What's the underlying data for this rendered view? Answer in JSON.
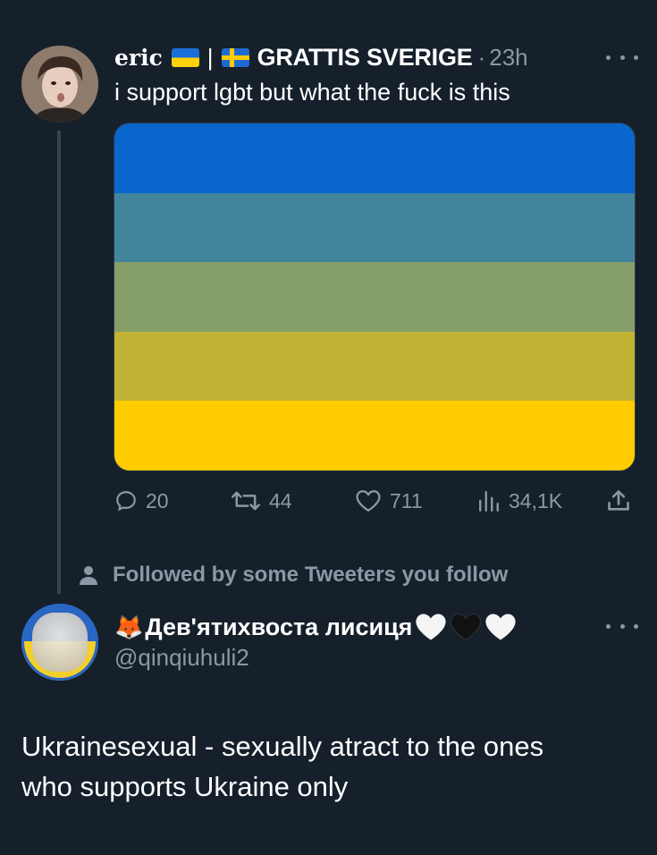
{
  "tweet": {
    "author_name": "eric",
    "author_flag_1": "ukraine-flag",
    "separator": "|",
    "author_flag_2": "sweden-flag",
    "author_name_suffix": "GRATTIS SVERIGE",
    "dot": "·",
    "timestamp": "23h",
    "text": "i support lgbt but what the fuck is this",
    "media_stripes": [
      "#0866cc",
      "#42849c",
      "#869e6a",
      "#c0b334",
      "#ffcc00"
    ],
    "actions": {
      "replies": "20",
      "retweets": "44",
      "likes": "711",
      "views": "34,1K"
    }
  },
  "followed_by": "Followed by some Tweeters you follow",
  "reply": {
    "author_emoji": "🦊",
    "author_name": "Дев'ятихвоста лисиця",
    "author_hearts": [
      "white-heart-icon",
      "black-heart-icon",
      "white-heart-icon"
    ],
    "handle": "@qinqiuhuli2",
    "text_lines": [
      "Ukrainesexual - sexually atract to the ones",
      "who supports Ukraine only"
    ]
  },
  "colors": {
    "background": "#15202b",
    "secondary_text": "#8b98a5",
    "thread_line": "#38444d"
  }
}
